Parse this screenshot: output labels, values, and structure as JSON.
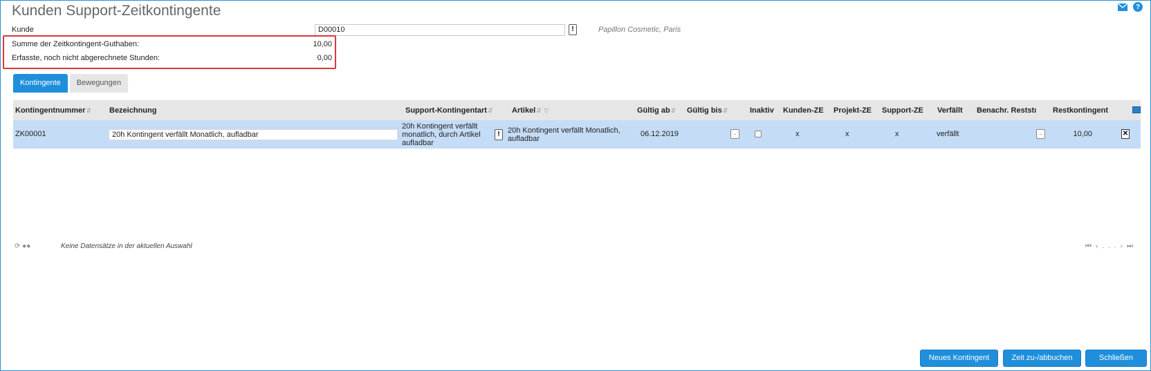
{
  "page": {
    "title": "Kunden Support-Zeitkontingente"
  },
  "icons": {
    "mail": "mail-icon",
    "help": "help-icon"
  },
  "form": {
    "kunde_label": "Kunde",
    "kunde_value": "D00010",
    "kunde_lookup": "!",
    "customer_name": "Papillon Cosmetic, Paris",
    "summe_label": "Summe der Zeitkontingent-Guthaben:",
    "summe_value": "10,00",
    "erfasste_label": "Erfasste, noch nicht abgerechnete Stunden:",
    "erfasste_value": "0,00"
  },
  "tabs": [
    {
      "label": "Kontingente",
      "active": true
    },
    {
      "label": "Bewegungen",
      "active": false
    }
  ],
  "grid": {
    "columns": {
      "kontingentnummer": "Kontingentnummer",
      "bezeichnung": "Bezeichnung",
      "support_kontingentart": "Support-Kontingentart",
      "artikel": "Artikel",
      "gueltig_ab": "Gültig ab",
      "gueltig_bis": "Gültig bis",
      "inaktiv": "Inaktiv",
      "kunden_ze": "Kunden-ZE",
      "projekt_ze": "Projekt-ZE",
      "support_ze": "Support-ZE",
      "verfaellt": "Verfällt",
      "benachr": "Benachr. Reststı",
      "restkontingent": "Restkontingent"
    },
    "rows": [
      {
        "kontingentnummer": "ZK00001",
        "bezeichnung": "20h Kontingent verfällt Monatlich, aufladbar",
        "support_kontingentart": "20h Kontingent verfällt monatlich, durch Artikel aufladbar",
        "artikel": "20h Kontingent verfällt Monatlich, aufladbar",
        "gueltig_ab": "06.12.2019",
        "gueltig_bis_btn": "..",
        "inaktiv": false,
        "kunden_ze": "x",
        "projekt_ze": "x",
        "support_ze": "x",
        "verfaellt": "verfällt",
        "benachr_btn": "..",
        "restkontingent": "10,00"
      }
    ],
    "status": "Keine Datensätze in der aktuellen Auswahl",
    "pager_dots": "..."
  },
  "buttons": {
    "neues_kontingent": "Neues Kontingent",
    "zeit_buchen": "Zeit zu-/abbuchen",
    "schliessen": "Schließen"
  }
}
